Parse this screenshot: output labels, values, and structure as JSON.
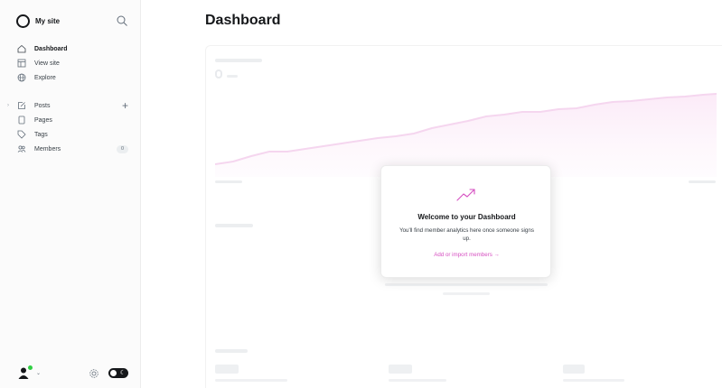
{
  "sidebar": {
    "site_name": "My site",
    "search_icon": "search-icon",
    "primary_nav": [
      {
        "label": "Dashboard",
        "icon": "home-icon",
        "active": true
      },
      {
        "label": "View site",
        "icon": "layout-icon"
      },
      {
        "label": "Explore",
        "icon": "globe-icon"
      }
    ],
    "content_nav": [
      {
        "label": "Posts",
        "icon": "edit-icon"
      },
      {
        "label": "Pages",
        "icon": "page-icon"
      },
      {
        "label": "Tags",
        "icon": "tag-icon"
      },
      {
        "label": "Members",
        "icon": "members-icon",
        "count": "0"
      }
    ]
  },
  "main": {
    "title": "Dashboard"
  },
  "modal": {
    "title": "Welcome to your Dashboard",
    "text": "You'll find member analytics here once someone signs up.",
    "link": "Add or import members →"
  },
  "colors": {
    "accent": "#d64fc1",
    "online_dot": "#30cf43",
    "chart_line": "#f5d6ef"
  }
}
